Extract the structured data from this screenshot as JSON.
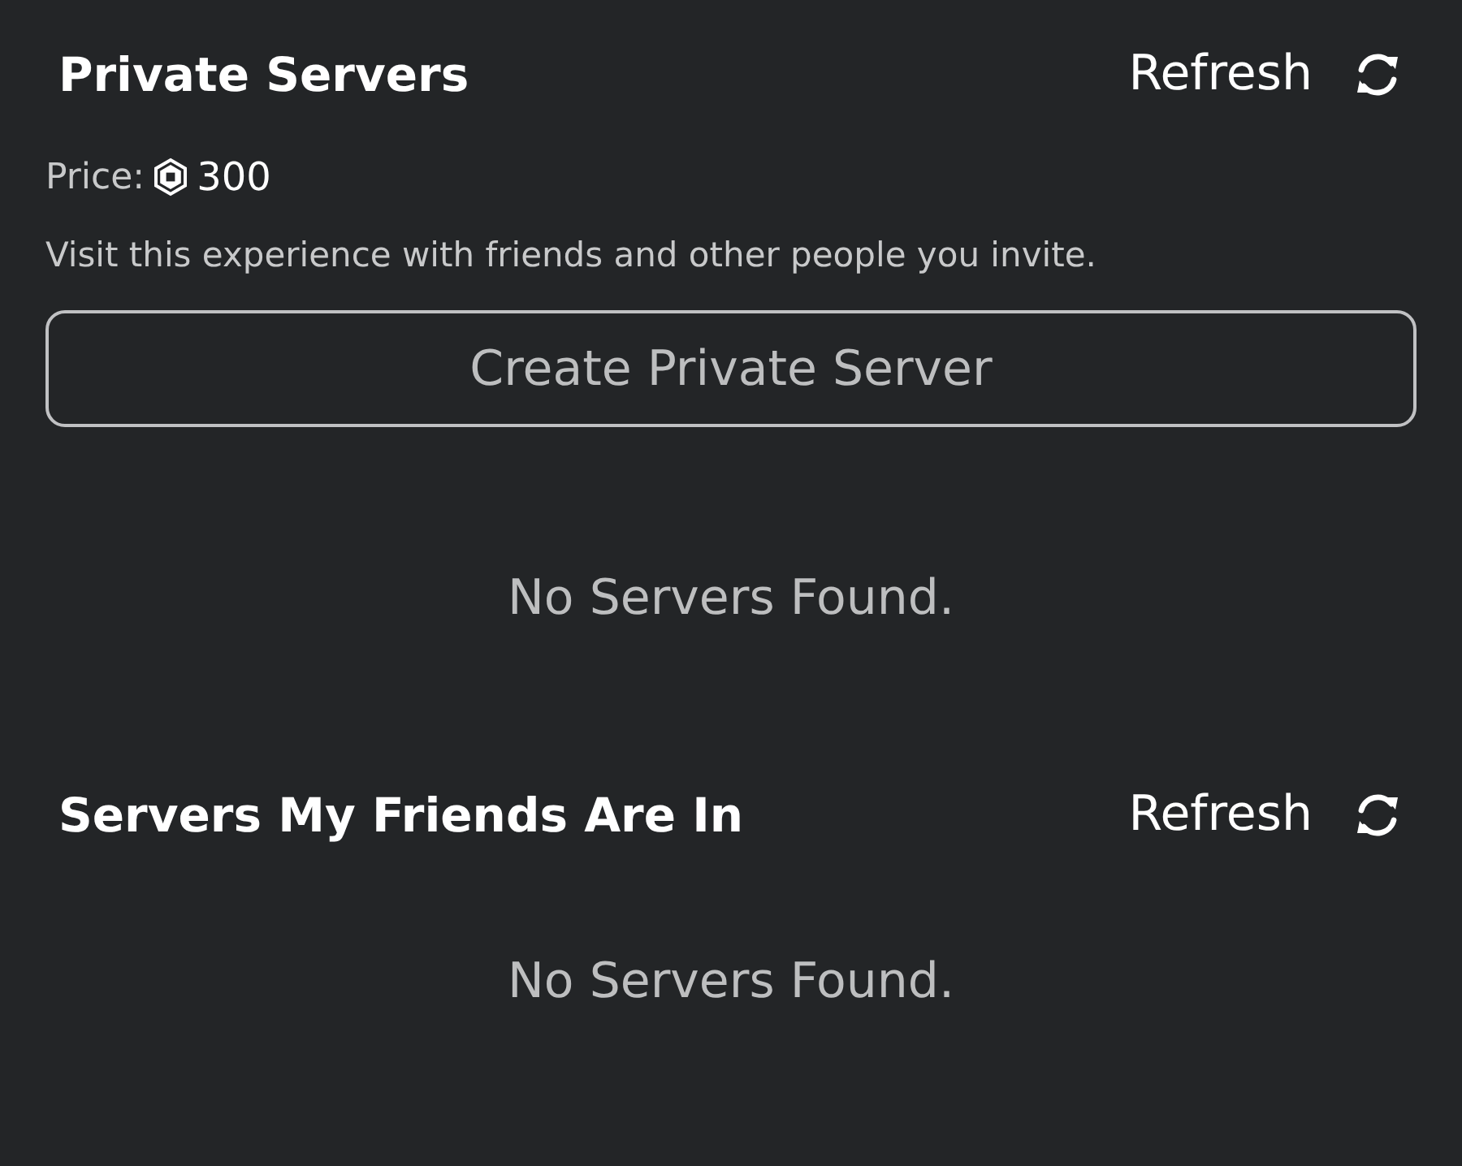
{
  "private_servers": {
    "title": "Private Servers",
    "refresh": "Refresh",
    "price_label": "Price:",
    "price": "300",
    "description": "Visit this experience with friends and other people you invite.",
    "create_button": "Create Private Server",
    "empty": "No Servers Found."
  },
  "friends_servers": {
    "title": "Servers My Friends Are In",
    "refresh": "Refresh",
    "empty": "No Servers Found."
  }
}
